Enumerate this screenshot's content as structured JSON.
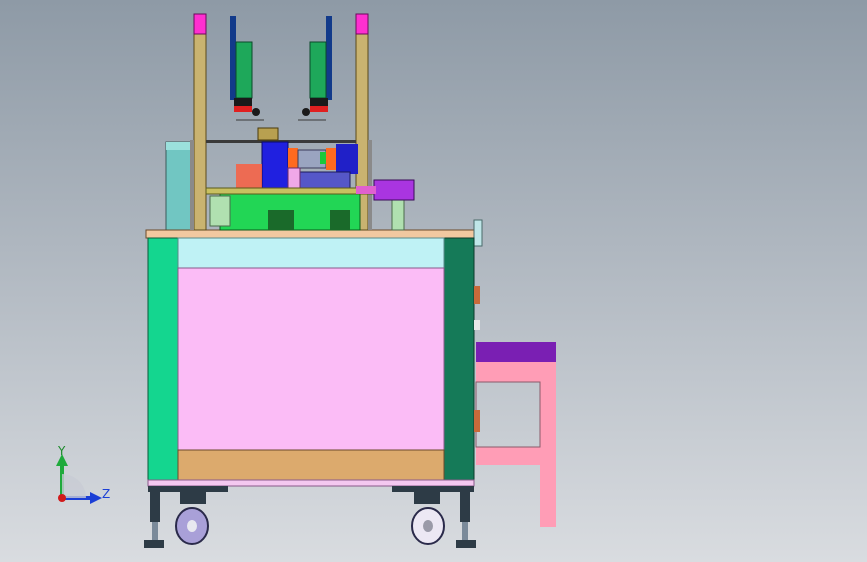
{
  "viewport": {
    "background_top": "#8e9aa6",
    "background_bottom": "#d9dce0"
  },
  "triad": {
    "y_label": "Y",
    "z_label": "Z",
    "y_color": "#1faa3c",
    "z_color": "#1b3fd6",
    "origin_color": "#d11a1a"
  },
  "colors": {
    "frame_left": "#14d68f",
    "frame_right": "#157a58",
    "top_plate": "#f1c8a0",
    "front_panel": "#fbbcf6",
    "upper_rail": "#bff2f5",
    "lower_rail": "#dcaa6d",
    "guide_column": "#c9b370",
    "column_cap": "#ff2fd0",
    "cylinder_bar": "#123a8a",
    "clamp_block": "#1ea85a",
    "motor_body": "#5557c8",
    "gearbox_blue": "#2020e0",
    "base_plate_green": "#22d655",
    "purple_box": "#a935e0",
    "side_table_pink": "#ff9db6",
    "side_table_top": "#7a1fb3",
    "left_panel": "#71c6c2",
    "caster_wheel": "#a9a0d8",
    "dark_metal": "#2d3b46"
  }
}
